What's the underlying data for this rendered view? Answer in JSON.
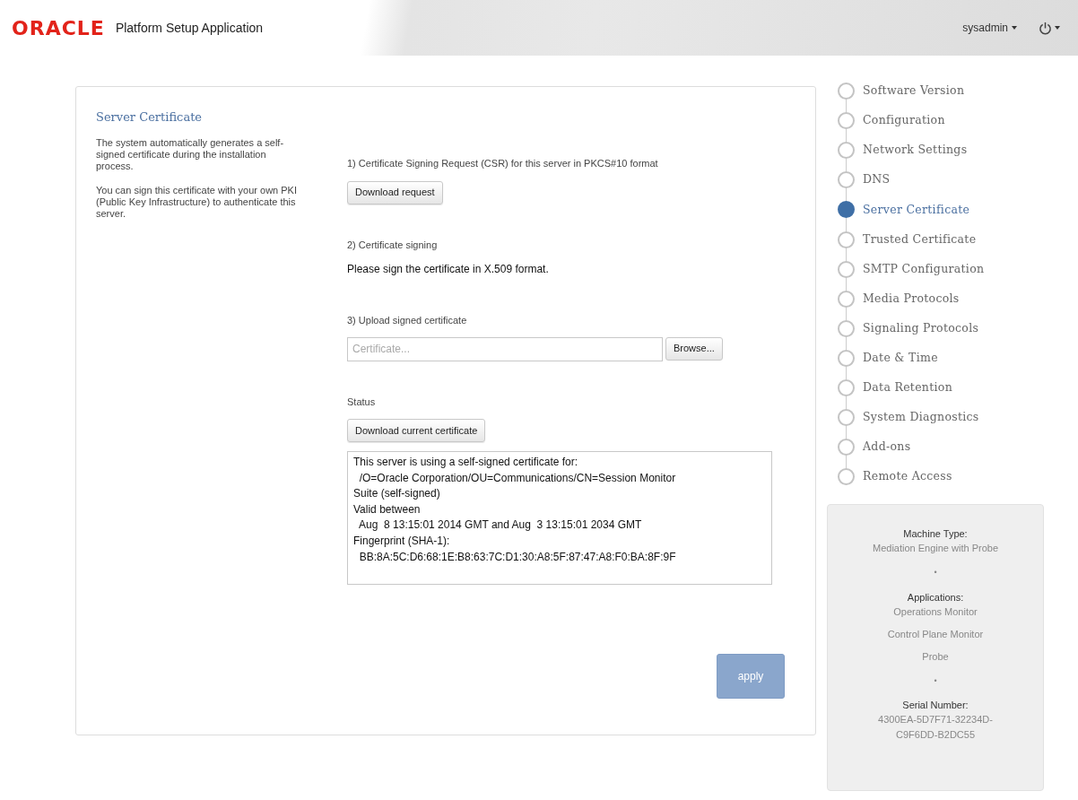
{
  "header": {
    "logo": "ORACLE",
    "app_title": "Platform Setup Application",
    "user_menu": "sysadmin"
  },
  "intro": {
    "title": "Server Certificate",
    "paragraphs": [
      "The system automatically generates a self-signed certificate during the installation process.",
      "You can sign this certificate with your own PKI (Public Key Infrastructure) to authenticate this server."
    ]
  },
  "steps_form": {
    "csr_label": "1) Certificate Signing Request (CSR) for this server in PKCS#10 format",
    "csr_button": "Download request",
    "signing_label": "2) Certificate signing",
    "signing_note": "Please sign the certificate in X.509 format.",
    "upload_label": "3) Upload signed certificate",
    "upload_field": {
      "placeholder": "Certificate..."
    },
    "browse_button": "Browse...",
    "status_label": "Status",
    "status_button": "Download current certificate",
    "status_lines": [
      "This server is using a self-signed certificate for:",
      "  /O=Oracle Corporation/OU=Communications/CN=Session Monitor",
      "Suite (self-signed)",
      "Valid between",
      "  Aug  8 13:15:01 2014 GMT and Aug  3 13:15:01 2034 GMT",
      "Fingerprint (SHA-1):",
      "  BB:8A:5C:D6:68:1E:B8:63:7C:D1:30:A8:5F:87:47:A8:F0:BA:8F:9F"
    ],
    "apply_button": {
      "label": "apply",
      "disabled": true
    }
  },
  "wizard_steps": [
    {
      "label": "Software Version",
      "selected": false
    },
    {
      "label": "Configuration",
      "selected": false
    },
    {
      "label": "Network Settings",
      "selected": false
    },
    {
      "label": "DNS",
      "selected": false
    },
    {
      "label": "Server Certificate",
      "selected": true
    },
    {
      "label": "Trusted Certificate",
      "selected": false
    },
    {
      "label": "SMTP Configuration",
      "selected": false
    },
    {
      "label": "Media Protocols",
      "selected": false
    },
    {
      "label": "Signaling Protocols",
      "selected": false
    },
    {
      "label": "Date & Time",
      "selected": false
    },
    {
      "label": "Data Retention",
      "selected": false
    },
    {
      "label": "System Diagnostics",
      "selected": false
    },
    {
      "label": "Add-ons",
      "selected": false
    },
    {
      "label": "Remote Access",
      "selected": false
    }
  ],
  "machine_info": [
    {
      "kind": "heading",
      "text": "Machine Type:"
    },
    {
      "kind": "value",
      "text": "Mediation Engine with Probe"
    },
    {
      "kind": "separator",
      "text": "•"
    },
    {
      "kind": "heading",
      "text": "Applications:"
    },
    {
      "kind": "value",
      "text": "Operations Monitor"
    },
    {
      "kind": "value",
      "text": "Control Plane Monitor"
    },
    {
      "kind": "value",
      "text": "Probe"
    },
    {
      "kind": "separator",
      "text": "•"
    },
    {
      "kind": "heading",
      "text": "Serial Number:"
    },
    {
      "kind": "value",
      "text": "4300EA-5D7F71-32234D-C9F6DD-B2DC55"
    }
  ]
}
